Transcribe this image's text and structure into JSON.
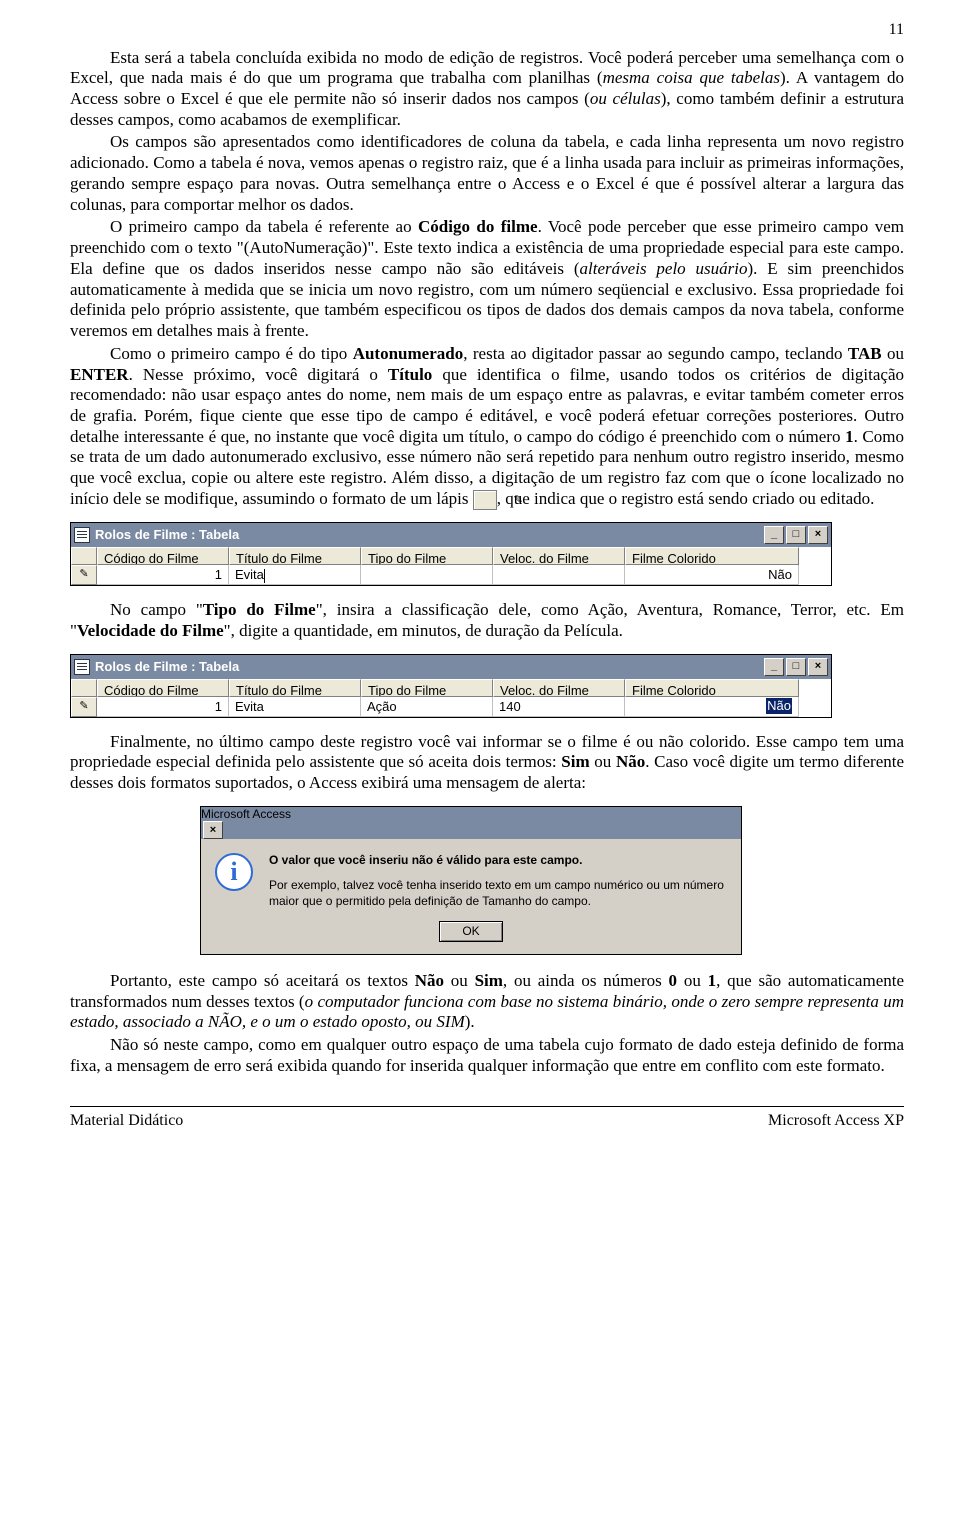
{
  "page_number": "11",
  "paragraphs": {
    "p1a": "Esta será a tabela concluída exibida no modo de edição de registros. Você poderá perceber uma semelhança com o Excel, que nada mais é do que um programa que trabalha com planilhas (",
    "p1b": "mesma coisa que tabelas",
    "p1c": "). A vantagem do Access sobre o Excel é que ele permite não só inserir dados nos campos (",
    "p1d": "ou células",
    "p1e": "), como também definir a estrutura desses campos, como acabamos de exemplificar.",
    "p2": "Os campos são apresentados como identificadores de coluna da tabela, e cada linha representa um novo registro adicionado. Como a tabela é nova, vemos apenas o registro raiz, que é a linha usada para incluir as primeiras informações, gerando sempre espaço para novas. Outra semelhança entre o Access e o Excel é que é possível alterar a largura das colunas, para comportar melhor os dados.",
    "p3a": "O primeiro campo da tabela é referente ao ",
    "p3b": "Código do filme",
    "p3c": ". Você pode perceber que esse primeiro campo vem preenchido com o texto \"(AutoNumeração)\". Este texto indica a existência de uma propriedade especial para este campo. Ela define que os dados inseridos nesse campo não são editáveis (",
    "p3d": "alteráveis pelo usuário",
    "p3e": "). E sim preenchidos automaticamente à medida que se inicia um novo registro, com um número seqüencial e exclusivo. Essa propriedade foi definida pelo próprio assistente, que também especificou os tipos de dados dos demais campos da nova tabela, conforme veremos em detalhes mais à frente.",
    "p4a": "Como o primeiro campo é do tipo ",
    "p4b": "Autonumerado",
    "p4c": ", resta ao digitador passar ao segundo campo, teclando ",
    "p4d": "TAB",
    "p4e": " ou ",
    "p4f": "ENTER",
    "p4g": ". Nesse próximo, você digitará o ",
    "p4h": "Título",
    "p4i": " que identifica o filme, usando todos os critérios de digitação recomendado: não usar espaço antes do nome, nem mais de um espaço entre as palavras, e evitar também cometer erros de grafia. Porém, fique ciente que esse tipo de campo é editável, e você poderá efetuar correções posteriores. Outro detalhe interessante é que, no instante que você digita um título, o campo do código é preenchido com o número ",
    "p4j": "1",
    "p4k": ". Como se trata de um dado autonumerado exclusivo, esse número não será repetido para nenhum outro registro inserido, mesmo que você exclua, copie ou altere este registro. Além disso, a digitação de um registro faz com que o ícone localizado no início dele se modifique, assumindo o formato de um lápis ",
    "p4l": ", que indica que o registro está sendo criado ou editado.",
    "p5a": "No campo \"",
    "p5b": "Tipo do Filme",
    "p5c": "\", insira a classificação dele, como Ação, Aventura, Romance, Terror, etc. Em \"",
    "p5d": "Velocidade do Filme",
    "p5e": "\", digite a quantidade, em minutos, de duração da Película.",
    "p6a": "Finalmente, no último campo deste registro você vai informar se o filme é ou não colorido. Esse campo tem uma propriedade especial definida pelo assistente que só aceita dois termos: ",
    "p6b": "Sim",
    "p6c": " ou ",
    "p6d": "Não",
    "p6e": ". Caso você digite um termo diferente desses dois formatos suportados, o Access exibirá uma mensagem de alerta:",
    "p7a": "Portanto, este campo só aceitará os textos ",
    "p7b": "Não",
    "p7c": " ou ",
    "p7d": "Sim",
    "p7e": ", ou ainda os números ",
    "p7f": "0",
    "p7g": " ou ",
    "p7h": "1",
    "p7i": ", que são automaticamente transformados num desses textos (",
    "p7j": "o computador funciona com base no sistema binário, onde o zero sempre representa um estado, associado a NÃO, e o um o estado oposto, ou SIM",
    "p7k": ").",
    "p8": "Não só neste campo, como em qualquer outro espaço de uma tabela cujo formato de dado esteja definido de forma fixa, a mensagem de erro será exibida quando for inserida qualquer informação que entre em conflito com este formato."
  },
  "table_window": {
    "title": "Rolos de Filme : Tabela",
    "columns": [
      "Código do Filme",
      "Título do Filme",
      "Tipo do Filme",
      "Veloc. do Filme",
      "Filme Colorido"
    ]
  },
  "table1_row": {
    "codigo": "1",
    "titulo": "Evita",
    "tipo": "",
    "veloc": "",
    "colorido": "Não"
  },
  "table2_row": {
    "codigo": "1",
    "titulo": "Evita",
    "tipo": "Ação",
    "veloc": "140",
    "colorido": "Não"
  },
  "pencil_glyph": "✎",
  "dialog": {
    "title": "Microsoft Access",
    "line1": "O valor que você inseriu não é válido para este campo.",
    "line2": "Por exemplo, talvez você tenha inserido texto em um campo numérico ou um número maior que o permitido pela definição de Tamanho do campo.",
    "ok": "OK"
  },
  "footer": {
    "left": "Material Didático",
    "right": "Microsoft Access XP"
  },
  "winbtn": {
    "min": "_",
    "max": "□",
    "close": "×"
  }
}
